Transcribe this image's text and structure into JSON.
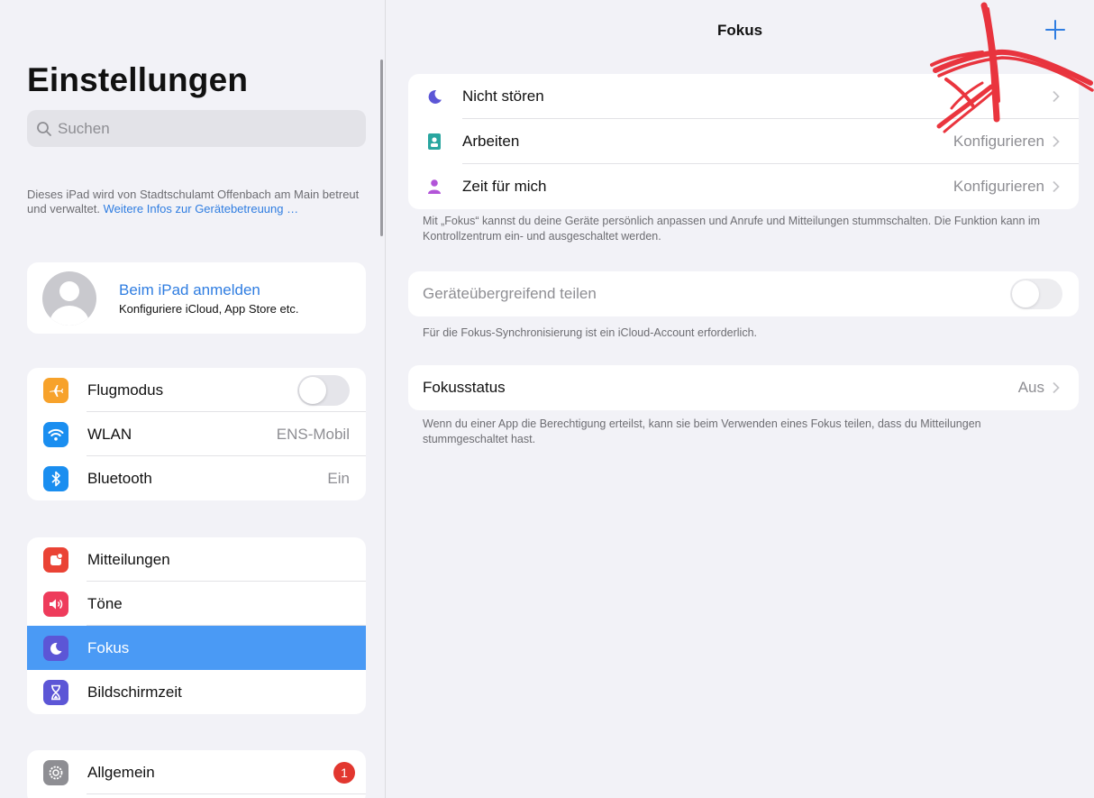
{
  "sidebar": {
    "title": "Einstellungen",
    "search_placeholder": "Suchen",
    "mdm_text": "Dieses iPad wird von Stadtschulamt Offenbach am Main betreut und verwaltet.",
    "mdm_link": "Weitere Infos zur Geräte­betreuung …",
    "profile": {
      "name": "Beim iPad anmelden",
      "subtitle": "Konfiguriere iCloud, App Store etc."
    },
    "group1": [
      {
        "label": "Flugmodus",
        "icon": "airplane-icon",
        "color": "#f7a22b"
      },
      {
        "label": "WLAN",
        "value": "ENS-Mobil",
        "icon": "wifi-icon",
        "color": "#1a8ef0"
      },
      {
        "label": "Bluetooth",
        "value": "Ein",
        "icon": "bluetooth-icon",
        "color": "#1a8ef0"
      }
    ],
    "group2": [
      {
        "label": "Mitteilungen",
        "icon": "notifications-icon",
        "color": "#ea4335"
      },
      {
        "label": "Töne",
        "icon": "speaker-icon",
        "color": "#ee3b5b"
      },
      {
        "label": "Fokus",
        "icon": "moon-icon",
        "color": "#5c56d6",
        "active": true
      },
      {
        "label": "Bildschirmzeit",
        "icon": "hourglass-icon",
        "color": "#5c56d6"
      }
    ],
    "group3": [
      {
        "label": "Allgemein",
        "icon": "gear-icon",
        "color": "#8e8e93",
        "badge": "1"
      }
    ]
  },
  "main": {
    "title": "Fokus",
    "focus_modes": [
      {
        "label": "Nicht stören",
        "value": "",
        "icon": "moon-icon",
        "color": "#5c56d6"
      },
      {
        "label": "Arbeiten",
        "value": "Konfigurieren",
        "icon": "id-badge-icon",
        "color": "#2aa6a0"
      },
      {
        "label": "Zeit für mich",
        "value": "Konfigurieren",
        "icon": "person-icon",
        "color": "#b254d8"
      }
    ],
    "focus_note": "Mit „Fokus“ kannst du deine Geräte persönlich anpassen und Anrufe und Mitteilungen stummschalten. Die Funktion kann im Kontrollzentrum ein- und ausgeschaltet werden.",
    "share_label": "Geräteübergreifend teilen",
    "share_note": "Für die Fokus-Synchronisierung ist ein iCloud-Account erforderlich.",
    "status_label": "Fokusstatus",
    "status_value": "Aus",
    "status_note": "Wenn du einer App die Berechtigung erteilst, kann sie beim Verwenden eines Fokus teilen, dass du Mitteilungen stummgeschaltet hast."
  },
  "colors": {
    "accent": "#2f7de1",
    "selection": "#4a9af5",
    "annotation": "#e8202a"
  }
}
